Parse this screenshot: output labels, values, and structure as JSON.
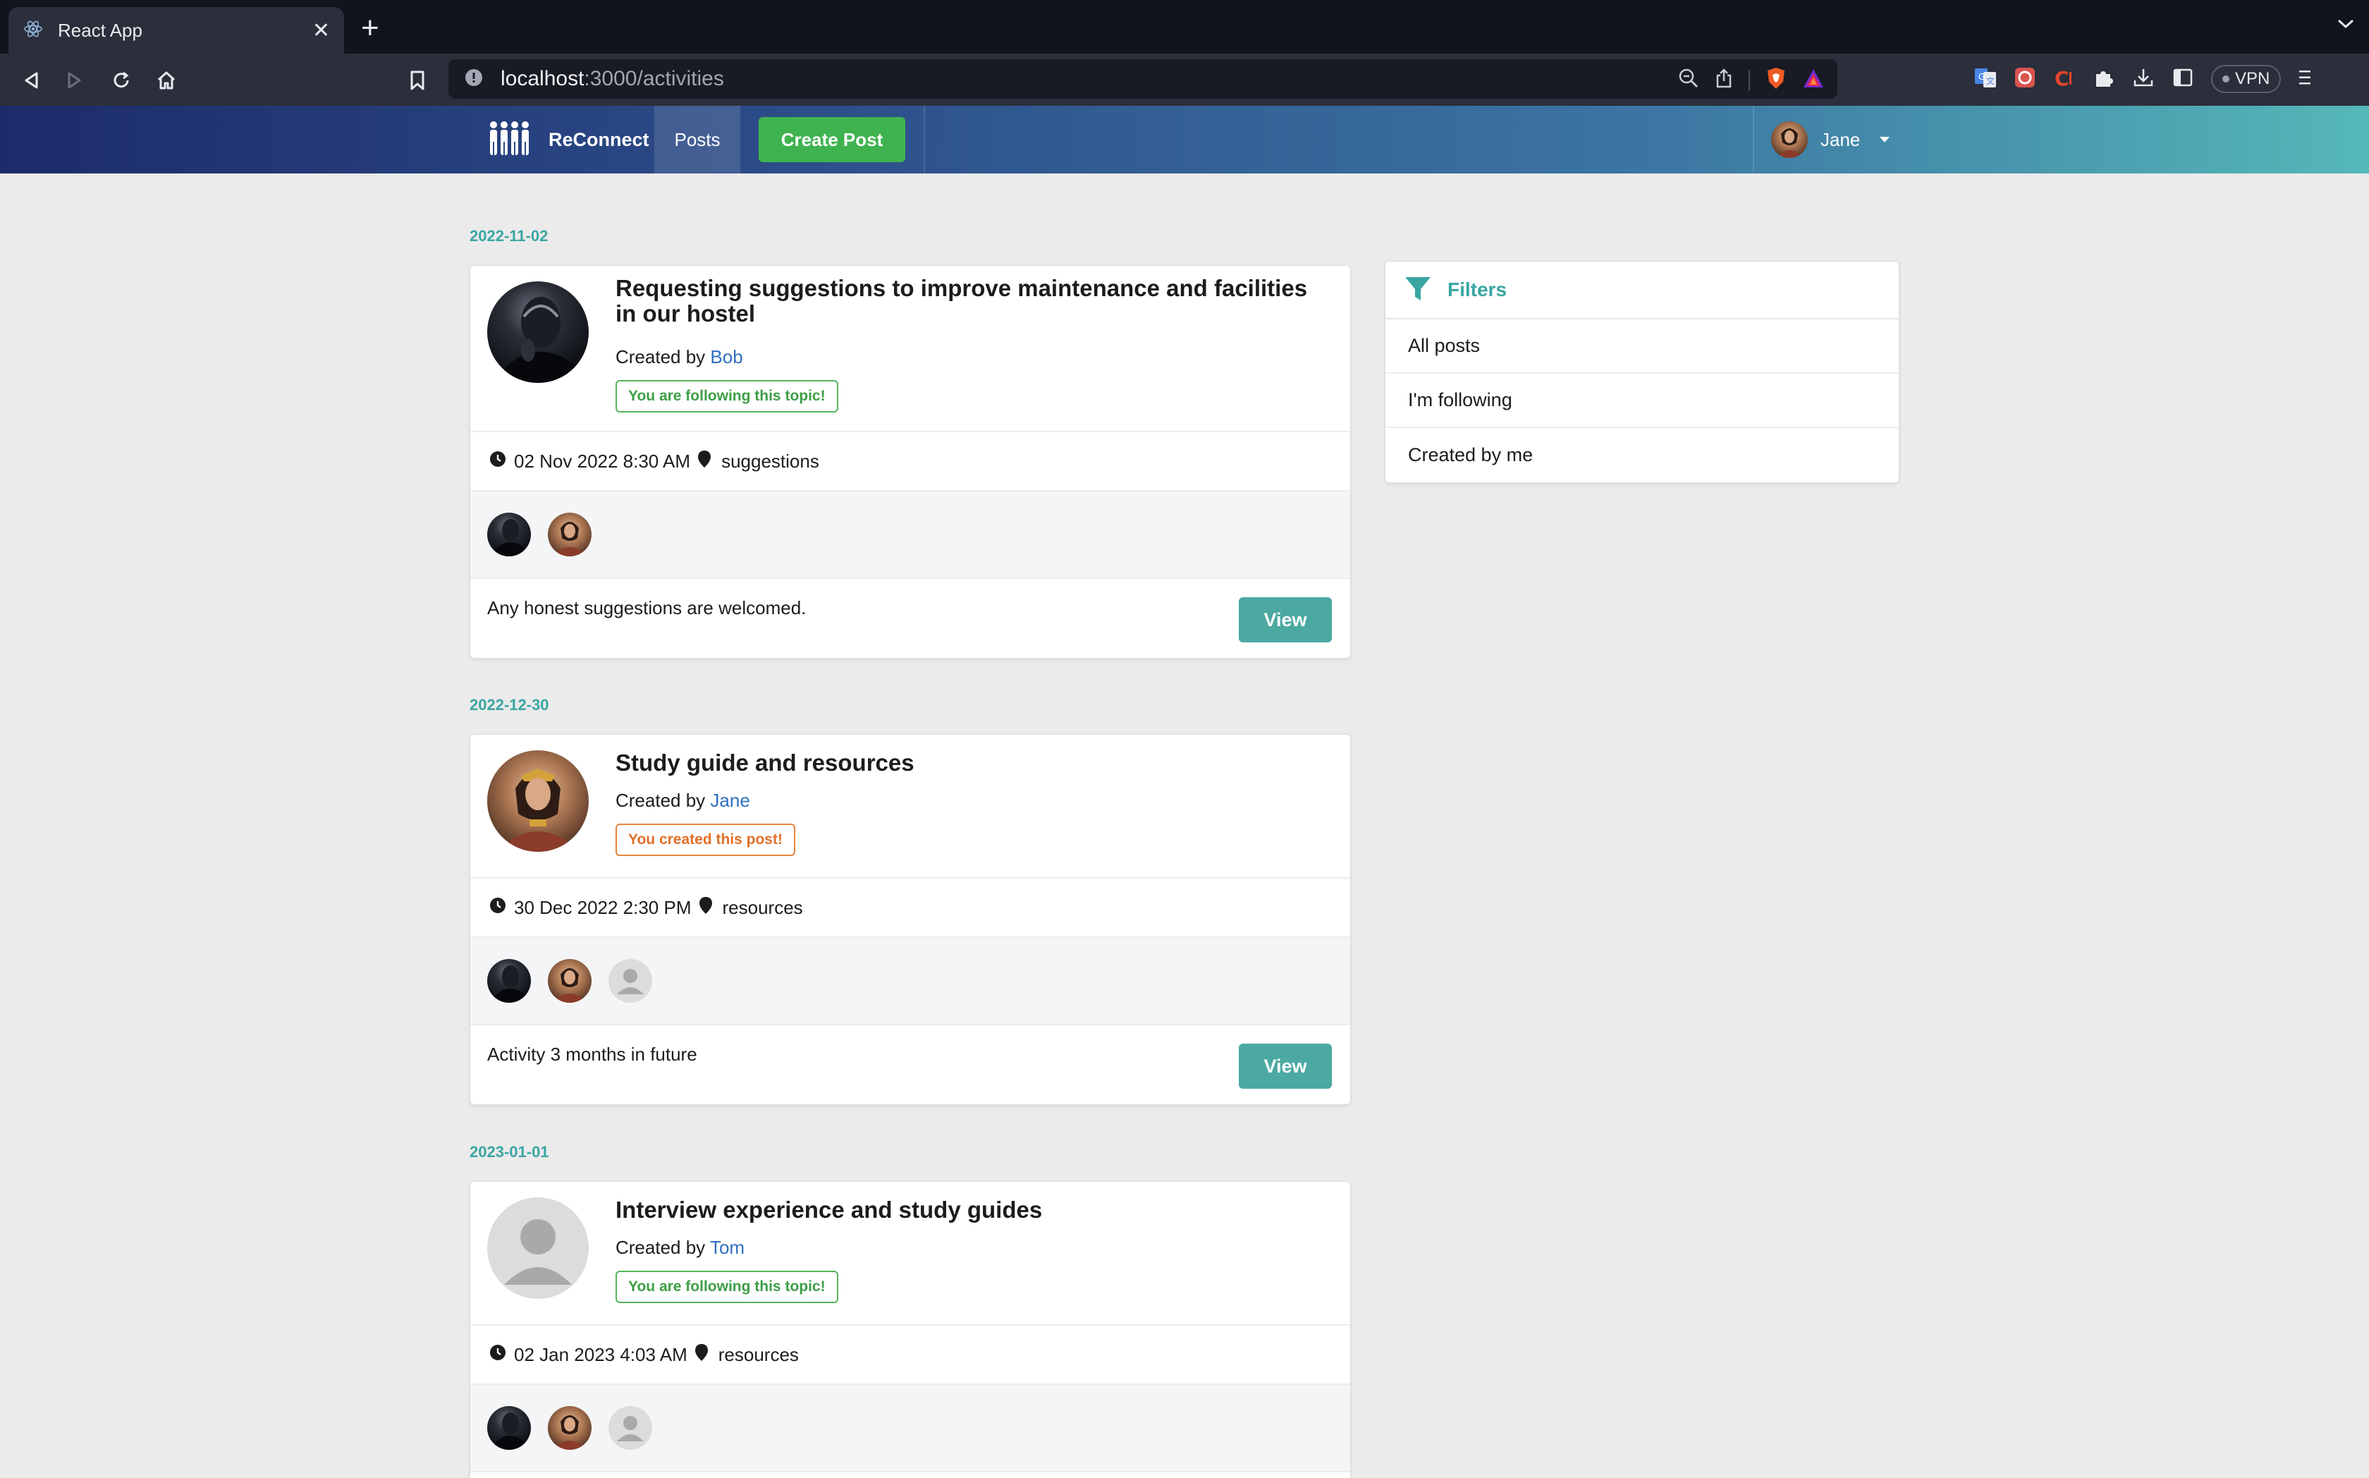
{
  "browser": {
    "tab_title": "React App",
    "url_host": "localhost",
    "url_path": ":3000/activities",
    "vpn_label": "VPN"
  },
  "header": {
    "brand": "ReConnect",
    "nav_posts": "Posts",
    "create_post": "Create Post",
    "user_name": "Jane"
  },
  "posts": [
    {
      "date_group": "2022-11-02",
      "title": "Requesting suggestions to improve maintenance and facilities in our hostel",
      "created_by_prefix": "Created by",
      "author": "Bob",
      "badge": "You are following this topic!",
      "datetime": "02 Nov 2022 8:30 AM",
      "category": "suggestions",
      "description": "Any honest suggestions are welcomed.",
      "view_label": "View"
    },
    {
      "date_group": "2022-12-30",
      "title": "Study guide and resources",
      "created_by_prefix": "Created by",
      "author": "Jane",
      "badge": "You created this post!",
      "datetime": "30 Dec 2022 2:30 PM",
      "category": "resources",
      "description": "Activity 3 months in future",
      "view_label": "View"
    },
    {
      "date_group": "2023-01-01",
      "title": "Interview experience and study guides",
      "created_by_prefix": "Created by",
      "author": "Tom",
      "badge": "You are following this topic!",
      "datetime": "02 Jan 2023 4:03 AM",
      "category": "resources"
    }
  ],
  "filters": {
    "title": "Filters",
    "items": [
      "All posts",
      "I'm following",
      "Created by me"
    ]
  },
  "colors": {
    "accent_teal": "#3aa6a3",
    "create_green": "#3fb34f",
    "view_button": "#4ba9a2",
    "link_blue": "#2f6fbf",
    "badge_green": "#52b45b",
    "badge_orange": "#e8833a"
  }
}
